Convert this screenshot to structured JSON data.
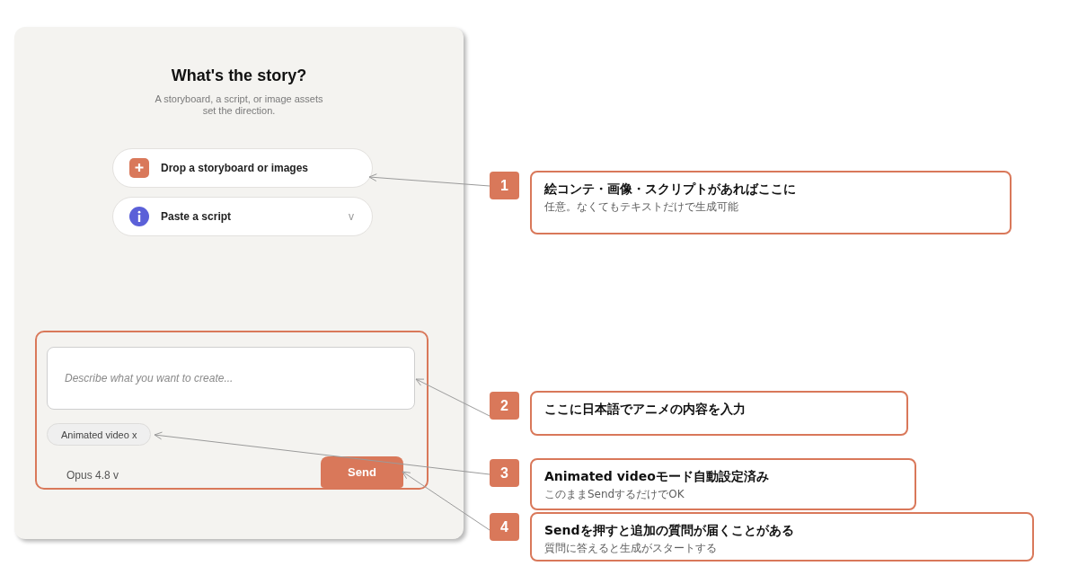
{
  "panel": {
    "title": "What's the story?",
    "subtitle": "A storyboard, a script, or image assets set the direction.",
    "options": [
      {
        "kind": "upload",
        "label": "Drop a storyboard or images"
      },
      {
        "kind": "script",
        "label": "Paste a script",
        "caret": "v"
      }
    ],
    "composer": {
      "highlighted": true,
      "placeholder": "Describe what you want to create...",
      "chips": [
        {
          "label": "Animated video x"
        }
      ],
      "model": "Opus 4.8 v",
      "send": "Send"
    }
  },
  "callouts": [
    {
      "number": "1",
      "title": "絵コンテ・画像・スクリプトがあればここに",
      "note": "任意。なくてもテキストだけで生成可能"
    },
    {
      "number": "2",
      "title": "ここに日本語でアニメの内容を入力"
    },
    {
      "number": "3",
      "title": "Animated videoモード自動設定済み",
      "note": "このままSendするだけでOK"
    },
    {
      "number": "4",
      "title": "Sendを押すと追加の質問が届くことがある",
      "note": "質問に答えると生成がスタートする"
    }
  ]
}
